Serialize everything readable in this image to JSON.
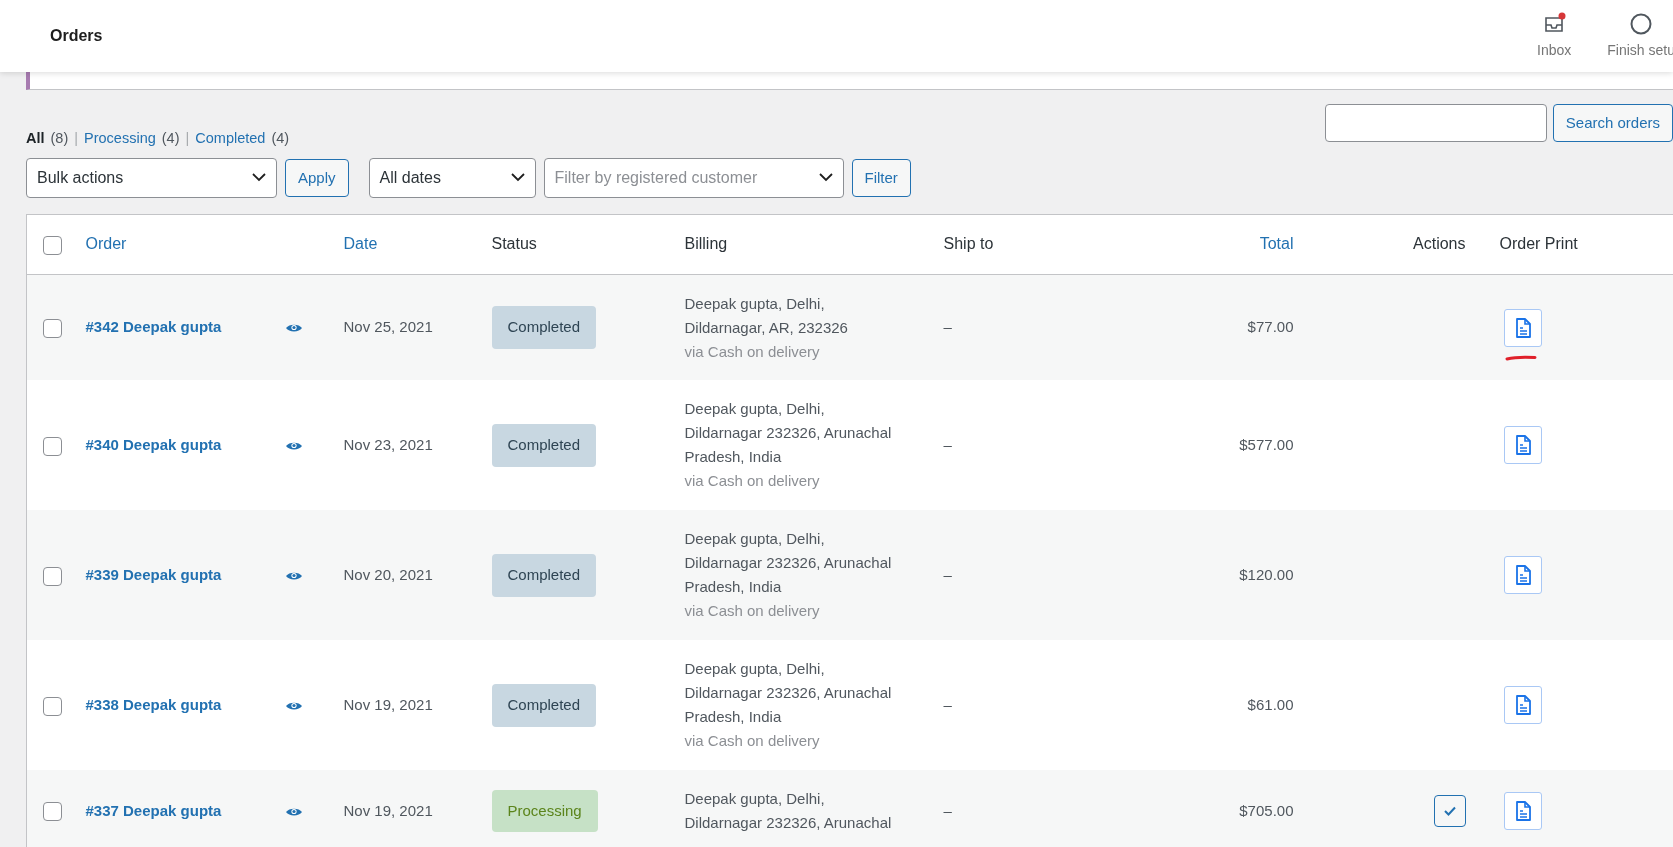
{
  "header": {
    "title": "Orders",
    "activity": [
      {
        "kind": "inbox",
        "label": "Inbox",
        "unread": true
      },
      {
        "kind": "setup",
        "label": "Finish setu",
        "unread": false
      }
    ]
  },
  "views": [
    {
      "label": "All",
      "count": "(8)",
      "selected": true
    },
    {
      "separator": "|",
      "label": "Processing",
      "count": "(4)",
      "selected": false
    },
    {
      "separator": "|",
      "label": "Completed",
      "count": "(4)",
      "selected": false
    }
  ],
  "search": {
    "button": "Search orders"
  },
  "bulk_actions": {
    "value": "Bulk actions",
    "button": "Apply"
  },
  "date_filter": {
    "value": "All dates"
  },
  "customer_filter": {
    "placeholder": "Filter by registered customer",
    "button": "Filter"
  },
  "table": {
    "select_all_checked": false,
    "columns": [
      {
        "label": "Order",
        "sortable": true
      },
      {
        "label": "Date",
        "sortable": true
      },
      {
        "label": "Status",
        "sortable": false
      },
      {
        "label": "Billing",
        "sortable": false
      },
      {
        "label": "Ship to",
        "sortable": false
      },
      {
        "label": "Total",
        "sortable": true
      },
      {
        "label": "Actions",
        "sortable": false
      },
      {
        "label": "Order Print",
        "sortable": false
      }
    ],
    "rows": [
      {
        "selected": false,
        "order": "#342 Deepak gupta",
        "date": "Nov 25, 2021",
        "status": "Completed",
        "color": "#c8d7e1",
        "billing": [
          "Deepak gupta, Delhi,",
          "Dildarnagar, AR, 232326"
        ],
        "payment": "via Cash on delivery",
        "ship_to": "–",
        "total": "$77.00",
        "annotated": true
      },
      {
        "selected": false,
        "order": "#340 Deepak gupta",
        "date": "Nov 23, 2021",
        "status": "Completed",
        "color": "#c8d7e1",
        "billing": [
          "Deepak gupta, Delhi,",
          "Dildarnagar 232326, Arunachal",
          "Pradesh, India"
        ],
        "payment": "via Cash on delivery",
        "ship_to": "–",
        "total": "$577.00",
        "annotated": false
      },
      {
        "selected": false,
        "order": "#339 Deepak gupta",
        "date": "Nov 20, 2021",
        "status": "Completed",
        "color": "#c8d7e1",
        "billing": [
          "Deepak gupta, Delhi,",
          "Dildarnagar 232326, Arunachal",
          "Pradesh, India"
        ],
        "payment": "via Cash on delivery",
        "ship_to": "–",
        "total": "$120.00",
        "annotated": false
      },
      {
        "selected": false,
        "order": "#338 Deepak gupta",
        "date": "Nov 19, 2021",
        "status": "Completed",
        "color": "#c8d7e1",
        "billing": [
          "Deepak gupta, Delhi,",
          "Dildarnagar 232326, Arunachal",
          "Pradesh, India"
        ],
        "payment": "via Cash on delivery",
        "ship_to": "–",
        "total": "$61.00",
        "annotated": false
      },
      {
        "selected": false,
        "order": "#337 Deepak gupta",
        "date": "Nov 19, 2021",
        "status": "Processing",
        "color": "#c6e1c6",
        "billing": [
          "Deepak gupta, Delhi,",
          "Dildarnagar 232326, Arunachal"
        ],
        "ship_to": "–",
        "total": "$705.00",
        "actions": [
          {
            "kind": "complete"
          }
        ],
        "annotated": false
      }
    ]
  }
}
